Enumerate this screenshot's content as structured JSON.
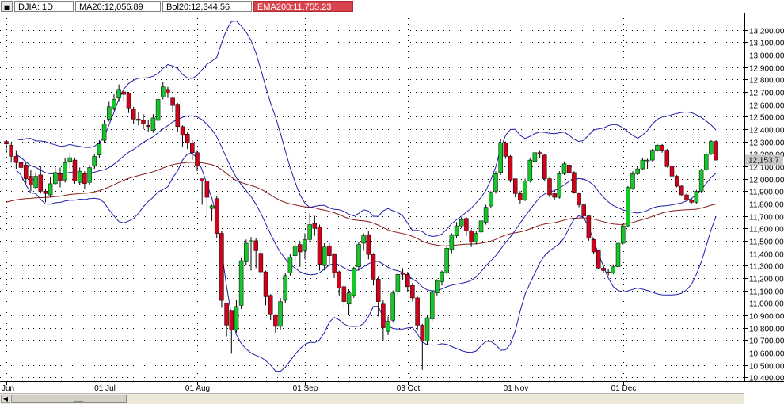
{
  "header": {
    "menu_icon": "window-menu-icon",
    "symbol": "DJIA: 1D",
    "ma": "MA20:12,056.89",
    "bol": "Bol20:12,344.56",
    "ema": "EMA200:11,755.23"
  },
  "colors": {
    "up": "#15c52a",
    "down": "#d0021b",
    "bands": "#1f1fa8",
    "ema": "#8b1a1a",
    "grid": "#000000",
    "price_tag_bg": "#c9c9c9"
  },
  "chart_data": {
    "type": "candlestick",
    "xlabel": "",
    "ylabel": "",
    "ylim": [
      10350,
      13300
    ],
    "y_ticks": [
      10400,
      10500,
      10600,
      10700,
      10800,
      10900,
      11000,
      11100,
      11200,
      11300,
      11400,
      11500,
      11600,
      11700,
      11800,
      11900,
      12000,
      12100,
      12200,
      12300,
      12400,
      12500,
      12600,
      12700,
      12800,
      12900,
      13000,
      13100,
      13200
    ],
    "x_ticks": [
      {
        "index": 0,
        "label": "Jun"
      },
      {
        "index": 20,
        "label": "01 Jul"
      },
      {
        "index": 39,
        "label": "01 Aug"
      },
      {
        "index": 61,
        "label": "01 Sep"
      },
      {
        "index": 82,
        "label": "03 Oct"
      },
      {
        "index": 104,
        "label": "01 Nov"
      },
      {
        "index": 126,
        "label": "01 Dec"
      }
    ],
    "last_price_label": "12,153.7",
    "last_price": 12153.7,
    "closes": [
      12280,
      12180,
      12130,
      12090,
      12000,
      11950,
      12020,
      11900,
      11880,
      11960,
      12050,
      11980,
      12130,
      12170,
      11980,
      12060,
      11960,
      12090,
      12180,
      12280,
      12440,
      12580,
      12640,
      12720,
      12680,
      12570,
      12480,
      12470,
      12440,
      12420,
      12490,
      12640,
      12740,
      12690,
      12590,
      12420,
      12350,
      12290,
      12210,
      12100,
      11980,
      11850,
      11780,
      11560,
      11020,
      10820,
      10780,
      10970,
      11340,
      11480,
      11500,
      11420,
      11250,
      11050,
      10910,
      10810,
      11010,
      11220,
      11370,
      11460,
      11410,
      11510,
      11630,
      11600,
      11310,
      11450,
      11380,
      11240,
      11120,
      11010,
      11080,
      11280,
      11470,
      11540,
      11390,
      11190,
      11010,
      10800,
      10850,
      11080,
      11230,
      11230,
      11130,
      11040,
      10820,
      10690,
      10880,
      11090,
      11180,
      11250,
      11440,
      11550,
      11620,
      11670,
      11580,
      11490,
      11560,
      11660,
      11770,
      11890,
      12040,
      12290,
      12180,
      11990,
      11880,
      11830,
      11980,
      12150,
      12210,
      12200,
      12000,
      11870,
      11850,
      12040,
      12120,
      12050,
      11890,
      11790,
      11700,
      11520,
      11410,
      11280,
      11260,
      11240,
      11290,
      11480,
      11620,
      11930,
      12040,
      12080,
      12150,
      12150,
      12230,
      12270,
      12230,
      12100,
      12020,
      11940,
      11870,
      11830,
      11810,
      11900,
      12070,
      12200,
      12300,
      12150
    ],
    "ohlc": [
      [
        12300,
        12310,
        12210,
        12280
      ],
      [
        12270,
        12290,
        12130,
        12180
      ],
      [
        12180,
        12230,
        12080,
        12130
      ],
      [
        12130,
        12200,
        12040,
        12090
      ],
      [
        12110,
        12130,
        11960,
        12000
      ],
      [
        12020,
        12070,
        11900,
        11950
      ],
      [
        11930,
        12050,
        11920,
        12020
      ],
      [
        12030,
        12100,
        11880,
        11900
      ],
      [
        11900,
        11920,
        11810,
        11880
      ],
      [
        11870,
        12010,
        11850,
        11960
      ],
      [
        11960,
        12090,
        11950,
        12050
      ],
      [
        12040,
        12090,
        11930,
        11980
      ],
      [
        11990,
        12170,
        11970,
        12130
      ],
      [
        12140,
        12210,
        12080,
        12170
      ],
      [
        12150,
        12170,
        11960,
        11980
      ],
      [
        11970,
        12090,
        11950,
        12060
      ],
      [
        12040,
        12060,
        11920,
        11960
      ],
      [
        11970,
        12110,
        11950,
        12090
      ],
      [
        12100,
        12200,
        12080,
        12180
      ],
      [
        12190,
        12310,
        12170,
        12280
      ],
      [
        12310,
        12470,
        12290,
        12440
      ],
      [
        12480,
        12620,
        12460,
        12580
      ],
      [
        12570,
        12680,
        12550,
        12640
      ],
      [
        12650,
        12760,
        12620,
        12720
      ],
      [
        12700,
        12720,
        12620,
        12680
      ],
      [
        12690,
        12700,
        12530,
        12570
      ],
      [
        12560,
        12580,
        12440,
        12480
      ],
      [
        12480,
        12540,
        12430,
        12470
      ],
      [
        12470,
        12520,
        12400,
        12440
      ],
      [
        12430,
        12470,
        12380,
        12420
      ],
      [
        12390,
        12520,
        12370,
        12490
      ],
      [
        12470,
        12660,
        12450,
        12640
      ],
      [
        12660,
        12780,
        12640,
        12740
      ],
      [
        12720,
        12740,
        12650,
        12690
      ],
      [
        12650,
        12660,
        12540,
        12590
      ],
      [
        12600,
        12610,
        12380,
        12420
      ],
      [
        12420,
        12430,
        12260,
        12350
      ],
      [
        12360,
        12380,
        12240,
        12290
      ],
      [
        12290,
        12310,
        12150,
        12210
      ],
      [
        12210,
        12230,
        12060,
        12100
      ],
      [
        12000,
        12000,
        11790,
        11980
      ],
      [
        11980,
        11990,
        11690,
        11850
      ],
      [
        11760,
        11790,
        11660,
        11780
      ],
      [
        11840,
        11860,
        11520,
        11560
      ],
      [
        11560,
        11580,
        10960,
        11020
      ],
      [
        11000,
        11000,
        10730,
        10820
      ],
      [
        10940,
        10940,
        10590,
        10780
      ],
      [
        10780,
        11020,
        10760,
        10970
      ],
      [
        10980,
        11360,
        10950,
        11340
      ],
      [
        11330,
        11510,
        11300,
        11480
      ],
      [
        11490,
        11530,
        11260,
        11500
      ],
      [
        11500,
        11520,
        11280,
        11420
      ],
      [
        11400,
        11430,
        11220,
        11250
      ],
      [
        11250,
        11260,
        10980,
        11050
      ],
      [
        11060,
        11070,
        10860,
        10910
      ],
      [
        10900,
        10910,
        10760,
        10810
      ],
      [
        10810,
        11040,
        10780,
        11010
      ],
      [
        11020,
        11240,
        11000,
        11220
      ],
      [
        11240,
        11390,
        11220,
        11370
      ],
      [
        11380,
        11500,
        11340,
        11460
      ],
      [
        11470,
        11490,
        11290,
        11410
      ],
      [
        11420,
        11560,
        11350,
        11510
      ],
      [
        11510,
        11720,
        11490,
        11630
      ],
      [
        11640,
        11700,
        11540,
        11600
      ],
      [
        11610,
        11630,
        11260,
        11310
      ],
      [
        11300,
        11480,
        11260,
        11450
      ],
      [
        11460,
        11480,
        11300,
        11380
      ],
      [
        11390,
        11400,
        11200,
        11240
      ],
      [
        11250,
        11260,
        11060,
        11120
      ],
      [
        11130,
        11150,
        10960,
        11010
      ],
      [
        10990,
        11110,
        10900,
        11080
      ],
      [
        11060,
        11290,
        11040,
        11280
      ],
      [
        11290,
        11490,
        11260,
        11470
      ],
      [
        11480,
        11560,
        11420,
        11540
      ],
      [
        11550,
        11580,
        11350,
        11390
      ],
      [
        11390,
        11400,
        11140,
        11190
      ],
      [
        11190,
        11210,
        10890,
        11010
      ],
      [
        10990,
        11020,
        10690,
        10800
      ],
      [
        10770,
        10890,
        10740,
        10850
      ],
      [
        10860,
        11100,
        10840,
        11080
      ],
      [
        11090,
        11260,
        11060,
        11230
      ],
      [
        11240,
        11280,
        11180,
        11230
      ],
      [
        11230,
        11250,
        11090,
        11130
      ],
      [
        11140,
        11160,
        11010,
        11040
      ],
      [
        11040,
        11050,
        10780,
        10820
      ],
      [
        10820,
        10830,
        10460,
        10690
      ],
      [
        10690,
        10900,
        10660,
        10880
      ],
      [
        10870,
        11100,
        10850,
        11090
      ],
      [
        11080,
        11190,
        11060,
        11180
      ],
      [
        11170,
        11260,
        11140,
        11250
      ],
      [
        11240,
        11460,
        11230,
        11440
      ],
      [
        11430,
        11560,
        11400,
        11550
      ],
      [
        11540,
        11650,
        11520,
        11620
      ],
      [
        11620,
        11690,
        11600,
        11670
      ],
      [
        11680,
        11690,
        11540,
        11580
      ],
      [
        11580,
        11590,
        11450,
        11490
      ],
      [
        11490,
        11580,
        11470,
        11560
      ],
      [
        11570,
        11680,
        11550,
        11660
      ],
      [
        11650,
        11790,
        11630,
        11770
      ],
      [
        11780,
        11900,
        11760,
        11890
      ],
      [
        11900,
        12060,
        11880,
        12040
      ],
      [
        12050,
        12320,
        12030,
        12290
      ],
      [
        12290,
        12300,
        12160,
        12180
      ],
      [
        12180,
        12190,
        11970,
        11990
      ],
      [
        12000,
        12000,
        11850,
        11880
      ],
      [
        11880,
        11900,
        11800,
        11830
      ],
      [
        11830,
        12000,
        11820,
        11980
      ],
      [
        11980,
        12170,
        11970,
        12150
      ],
      [
        12140,
        12230,
        12120,
        12210
      ],
      [
        12210,
        12230,
        12170,
        12200
      ],
      [
        12190,
        12200,
        11980,
        12000
      ],
      [
        12000,
        12010,
        11850,
        11870
      ],
      [
        11880,
        11890,
        11830,
        11850
      ],
      [
        11850,
        12060,
        11840,
        12040
      ],
      [
        12040,
        12140,
        12030,
        12120
      ],
      [
        12110,
        12120,
        12040,
        12050
      ],
      [
        12050,
        12060,
        11880,
        11890
      ],
      [
        11880,
        11890,
        11770,
        11790
      ],
      [
        11790,
        11800,
        11690,
        11700
      ],
      [
        11700,
        11710,
        11500,
        11520
      ],
      [
        11510,
        11520,
        11390,
        11410
      ],
      [
        11420,
        11430,
        11270,
        11280
      ],
      [
        11280,
        11300,
        11240,
        11260
      ],
      [
        11250,
        11270,
        11220,
        11240
      ],
      [
        11240,
        11310,
        11230,
        11290
      ],
      [
        11290,
        11490,
        11280,
        11480
      ],
      [
        11480,
        11630,
        11470,
        11620
      ],
      [
        11620,
        11940,
        11610,
        11930
      ],
      [
        11920,
        12060,
        11910,
        12040
      ],
      [
        12040,
        12100,
        12030,
        12080
      ],
      [
        12080,
        12170,
        12070,
        12150
      ],
      [
        12150,
        12160,
        12080,
        12150
      ],
      [
        12150,
        12240,
        12140,
        12230
      ],
      [
        12230,
        12280,
        12220,
        12270
      ],
      [
        12270,
        12280,
        12210,
        12230
      ],
      [
        12230,
        12240,
        12090,
        12100
      ],
      [
        12100,
        12110,
        12010,
        12020
      ],
      [
        12020,
        12030,
        11930,
        11940
      ],
      [
        11940,
        11950,
        11860,
        11870
      ],
      [
        11870,
        11880,
        11820,
        11830
      ],
      [
        11830,
        11840,
        11800,
        11810
      ],
      [
        11810,
        11910,
        11800,
        11900
      ],
      [
        11900,
        12080,
        11890,
        12070
      ],
      [
        12070,
        12210,
        12060,
        12200
      ],
      [
        12200,
        12310,
        12190,
        12300
      ],
      [
        12300,
        12310,
        12150,
        12150
      ]
    ]
  }
}
